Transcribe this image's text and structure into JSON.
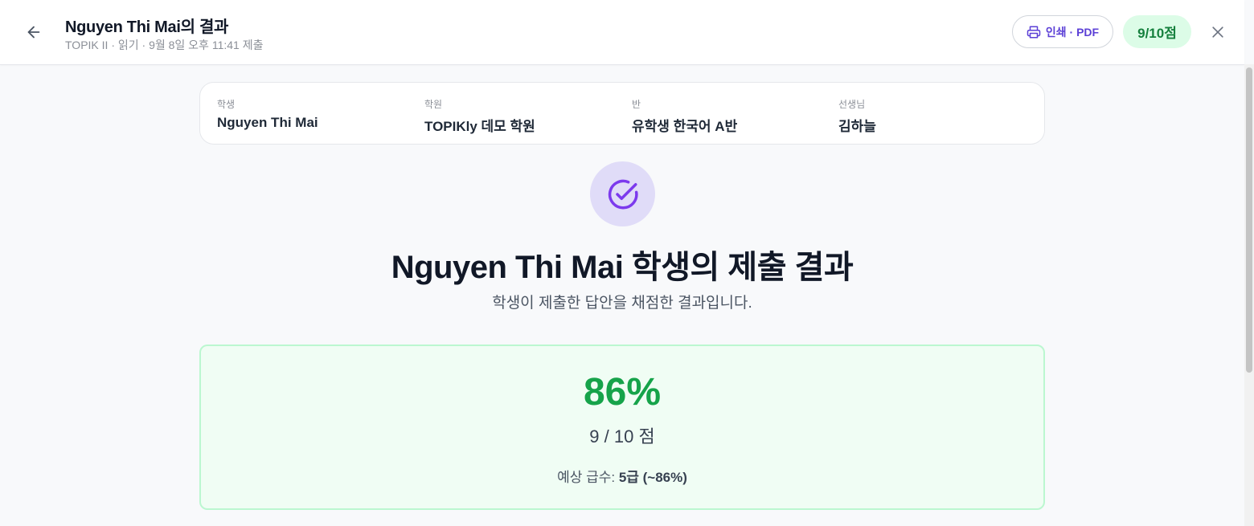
{
  "header": {
    "title": "Nguyen Thi Mai의 결과",
    "subtitle": "TOPIK II · 읽기 · 9월 8일 오후 11:41 제출",
    "print_label": "인쇄 · PDF",
    "score_badge": "9/10점",
    "icons": {
      "back": "arrow-left-icon",
      "print": "printer-icon",
      "close": "close-icon"
    }
  },
  "info": [
    {
      "label": "학생",
      "value": "Nguyen Thi Mai"
    },
    {
      "label": "학원",
      "value": "TOPIKly 데모 학원"
    },
    {
      "label": "반",
      "value": "유학생 한국어 A반"
    },
    {
      "label": "선생님",
      "value": "김하늘"
    }
  ],
  "main": {
    "icon": "check-circle-icon",
    "title": "Nguyen Thi Mai 학생의 제출 결과",
    "subtitle": "학생이 제출한 답안을 채점한 결과입니다."
  },
  "result": {
    "percent": "86%",
    "points": "9 / 10 점",
    "grade_label": "예상 급수:",
    "grade_value": "5급 (~86%)"
  },
  "colors": {
    "accent": "#5b3fd6",
    "success": "#16a34a",
    "success_bg": "#f0fdf4",
    "badge_bg": "#dcfce7",
    "icon_circle_bg": "#e0dcf8"
  }
}
